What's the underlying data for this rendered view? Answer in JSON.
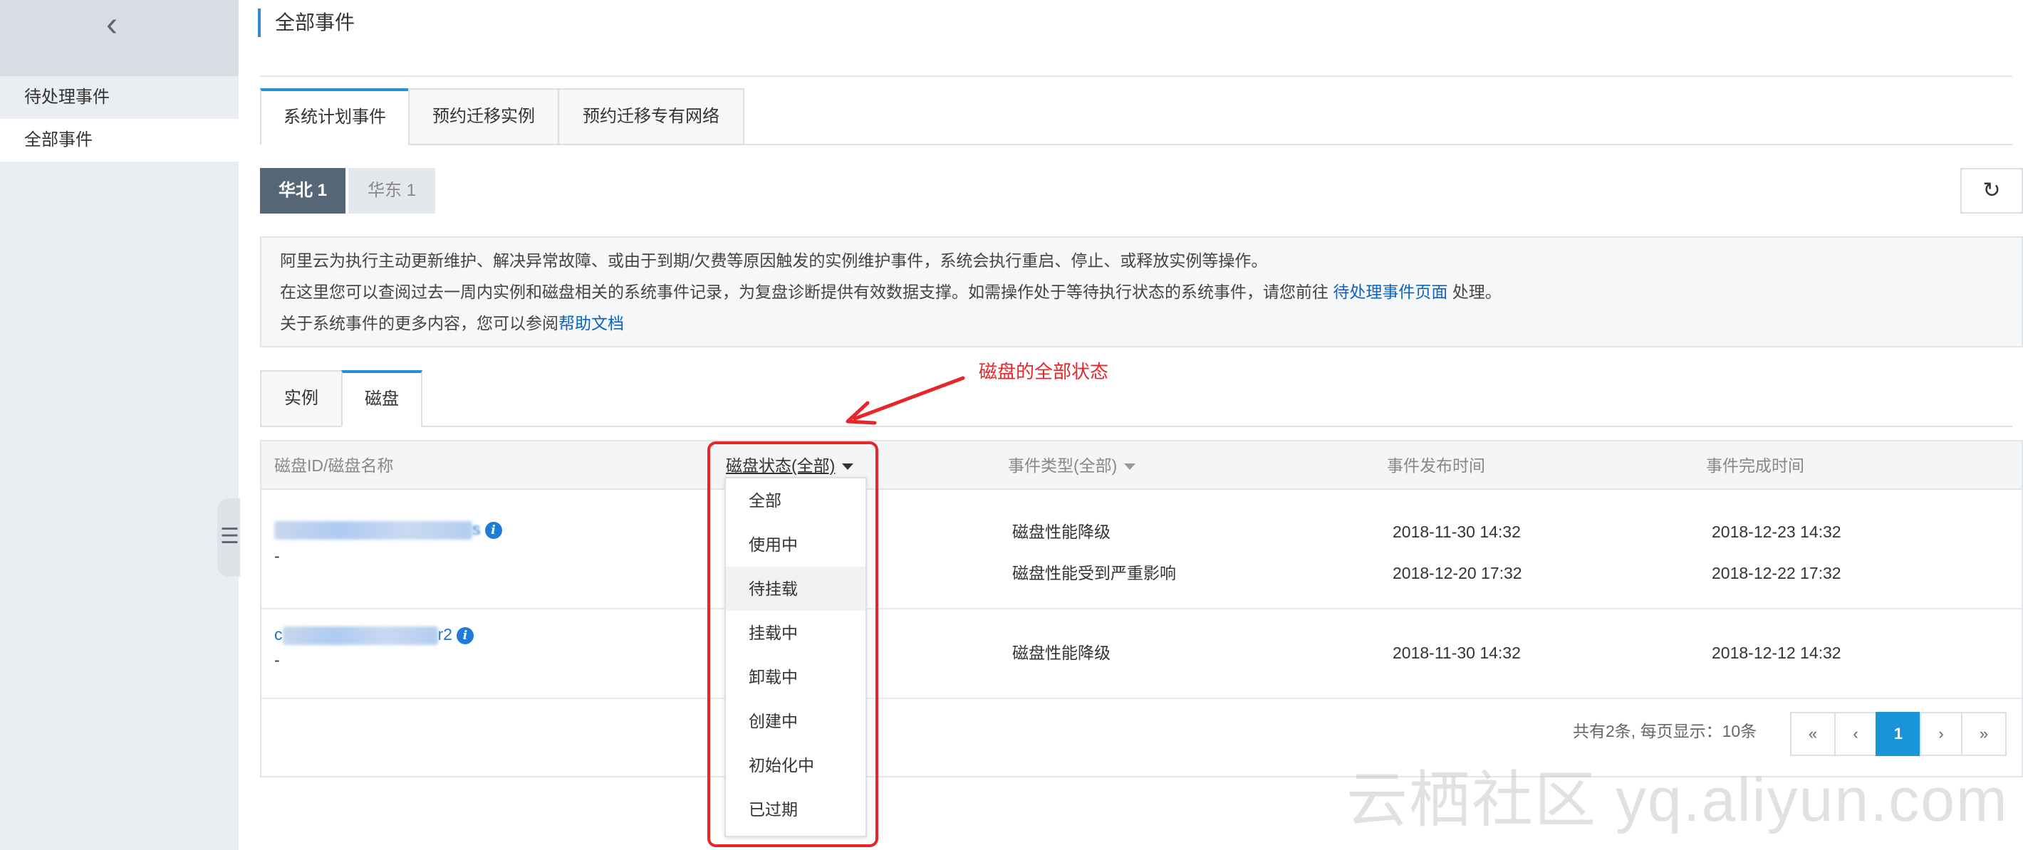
{
  "sidebar": {
    "back_icon": "chevron-left-icon",
    "items": [
      {
        "label": "待处理事件"
      },
      {
        "label": "全部事件"
      }
    ],
    "collapse_icon": "list-toggle-icon"
  },
  "header": {
    "title": "全部事件"
  },
  "top_tabs": [
    {
      "label": "系统计划事件",
      "active": true
    },
    {
      "label": "预约迁移实例",
      "active": false
    },
    {
      "label": "预约迁移专有网络",
      "active": false
    }
  ],
  "regions": [
    {
      "label": "华北 1",
      "active": true
    },
    {
      "label": "华东 1",
      "active": false
    }
  ],
  "refresh_icon": "refresh-icon",
  "notice": {
    "line1": "阿里云为执行主动更新维护、解决异常故障、或由于到期/欠费等原因触发的实例维护事件，系统会执行重启、停止、或释放实例等操作。",
    "line2_pre": "在这里您可以查阅过去一周内实例和磁盘相关的系统事件记录，为复盘诊断提供有效数据支撑。如需操作处于等待执行状态的系统事件，请您前往 ",
    "line2_link": "待处理事件页面",
    "line2_post": " 处理。",
    "line3_pre": "关于系统事件的更多内容，您可以参阅",
    "line3_link": "帮助文档"
  },
  "annotation": {
    "text": "磁盘的全部状态",
    "color": "#e8262a"
  },
  "inner_tabs": [
    {
      "label": "实例",
      "active": false
    },
    {
      "label": "磁盘",
      "active": true
    }
  ],
  "table": {
    "headers": {
      "disk_id": "磁盘ID/磁盘名称",
      "disk_status": "磁盘状态(全部)",
      "event_type": "事件类型(全部)",
      "publish_time": "事件发布时间",
      "finish_time": "事件完成时间"
    },
    "rows": [
      {
        "id_suffix": "s",
        "name": "-",
        "events": [
          {
            "type": "磁盘性能降级",
            "publish": "2018-11-30 14:32",
            "finish": "2018-12-23 14:32"
          },
          {
            "type": "磁盘性能受到严重影响",
            "publish": "2018-12-20 17:32",
            "finish": "2018-12-22 17:32"
          }
        ]
      },
      {
        "id_prefix": "c",
        "id_suffix": "r2",
        "name": "-",
        "events": [
          {
            "type": "磁盘性能降级",
            "publish": "2018-11-30 14:32",
            "finish": "2018-12-12 14:32"
          }
        ]
      }
    ]
  },
  "pagination": {
    "summary": "共有2条, 每页显示：10条",
    "first": "«",
    "prev": "‹",
    "current": "1",
    "next": "›",
    "last": "»"
  },
  "status_dropdown": {
    "options": [
      "全部",
      "使用中",
      "待挂载",
      "挂载中",
      "卸载中",
      "创建中",
      "初始化中",
      "已过期"
    ],
    "highlighted": "待挂载"
  },
  "watermark": "云栖社区 yq.aliyun.com"
}
